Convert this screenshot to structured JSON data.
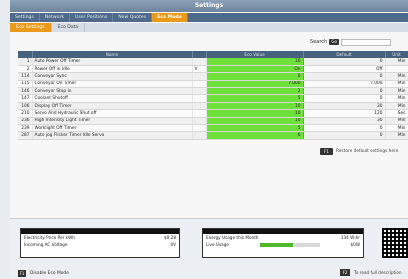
{
  "window": {
    "title": "Settings"
  },
  "main_tabs": [
    {
      "label": "Settings",
      "active": false
    },
    {
      "label": "Network",
      "active": false
    },
    {
      "label": "User Positions",
      "active": false
    },
    {
      "label": "New Quotes",
      "active": false
    },
    {
      "label": "Eco Mode",
      "active": true
    }
  ],
  "sub_tabs": [
    {
      "label": "Eco Settings",
      "active": true
    },
    {
      "label": "Eco Data",
      "active": false
    }
  ],
  "search": {
    "label": "Search",
    "button": "Go",
    "value": ""
  },
  "table": {
    "columns": [
      "",
      "Name",
      "",
      "Eco Value",
      "Default",
      "Unit"
    ],
    "rows": [
      {
        "id": "1",
        "name": "Auto Power Off Timer",
        "flag": "",
        "value": "10",
        "default": "0",
        "unit": "Min"
      },
      {
        "id": "2",
        "name": "Power Off in Idle",
        "flag": "V",
        "value": "On",
        "default": "Off",
        "unit": ""
      },
      {
        "id": "114",
        "name": "Conveyor Sync",
        "flag": "",
        "value": "0",
        "default": "0",
        "unit": "Min"
      },
      {
        "id": "115",
        "name": "Conveyor On Timer",
        "flag": "",
        "value": "7.000",
        "default": "7.000",
        "unit": "Min"
      },
      {
        "id": "146",
        "name": "Conveyor Stop In",
        "flag": "",
        "value": "2",
        "default": "0",
        "unit": "Min"
      },
      {
        "id": "147",
        "name": "Coolant Shutoff",
        "flag": "",
        "value": "5",
        "default": "0",
        "unit": "Min"
      },
      {
        "id": "106",
        "name": "Display Off Timer",
        "flag": "",
        "value": "10",
        "default": "30",
        "unit": "Min"
      },
      {
        "id": "210",
        "name": "Servo And Hydraulic Shut off",
        "flag": "",
        "value": "10",
        "default": "120",
        "unit": "Sec"
      },
      {
        "id": "236",
        "name": "High Intensity Light Timer",
        "flag": "",
        "value": "10",
        "default": "30",
        "unit": "Min"
      },
      {
        "id": "239",
        "name": "Worklight Off Timer",
        "flag": "",
        "value": "5",
        "default": "0",
        "unit": "Min"
      },
      {
        "id": "287",
        "name": "Auto jog Flicker Timer Idle Servo",
        "flag": "",
        "value": "6",
        "default": "0",
        "unit": "Min"
      }
    ]
  },
  "restore": {
    "button": "F1",
    "label": "Restore default settings here"
  },
  "footer": {
    "electricity": {
      "rows": [
        {
          "label": "Electricity Price Per kWh",
          "value": "$0.28"
        },
        {
          "label": "Incoming AC Voltage",
          "value": "0V"
        }
      ]
    },
    "energy": {
      "rows": [
        {
          "label": "Energy Usage this Month",
          "value": "134 W-hr"
        },
        {
          "label": "Live Usage",
          "value": "$0W"
        }
      ],
      "live_usage_fraction": 0.55
    },
    "enable": {
      "button": "F1",
      "label": "Disable Eco Mode"
    },
    "help": {
      "button": "F2",
      "label": "To read full description"
    }
  },
  "colors": {
    "accent": "#e99a1b",
    "header": "#47627f",
    "value_cell": "#6ee03a"
  }
}
